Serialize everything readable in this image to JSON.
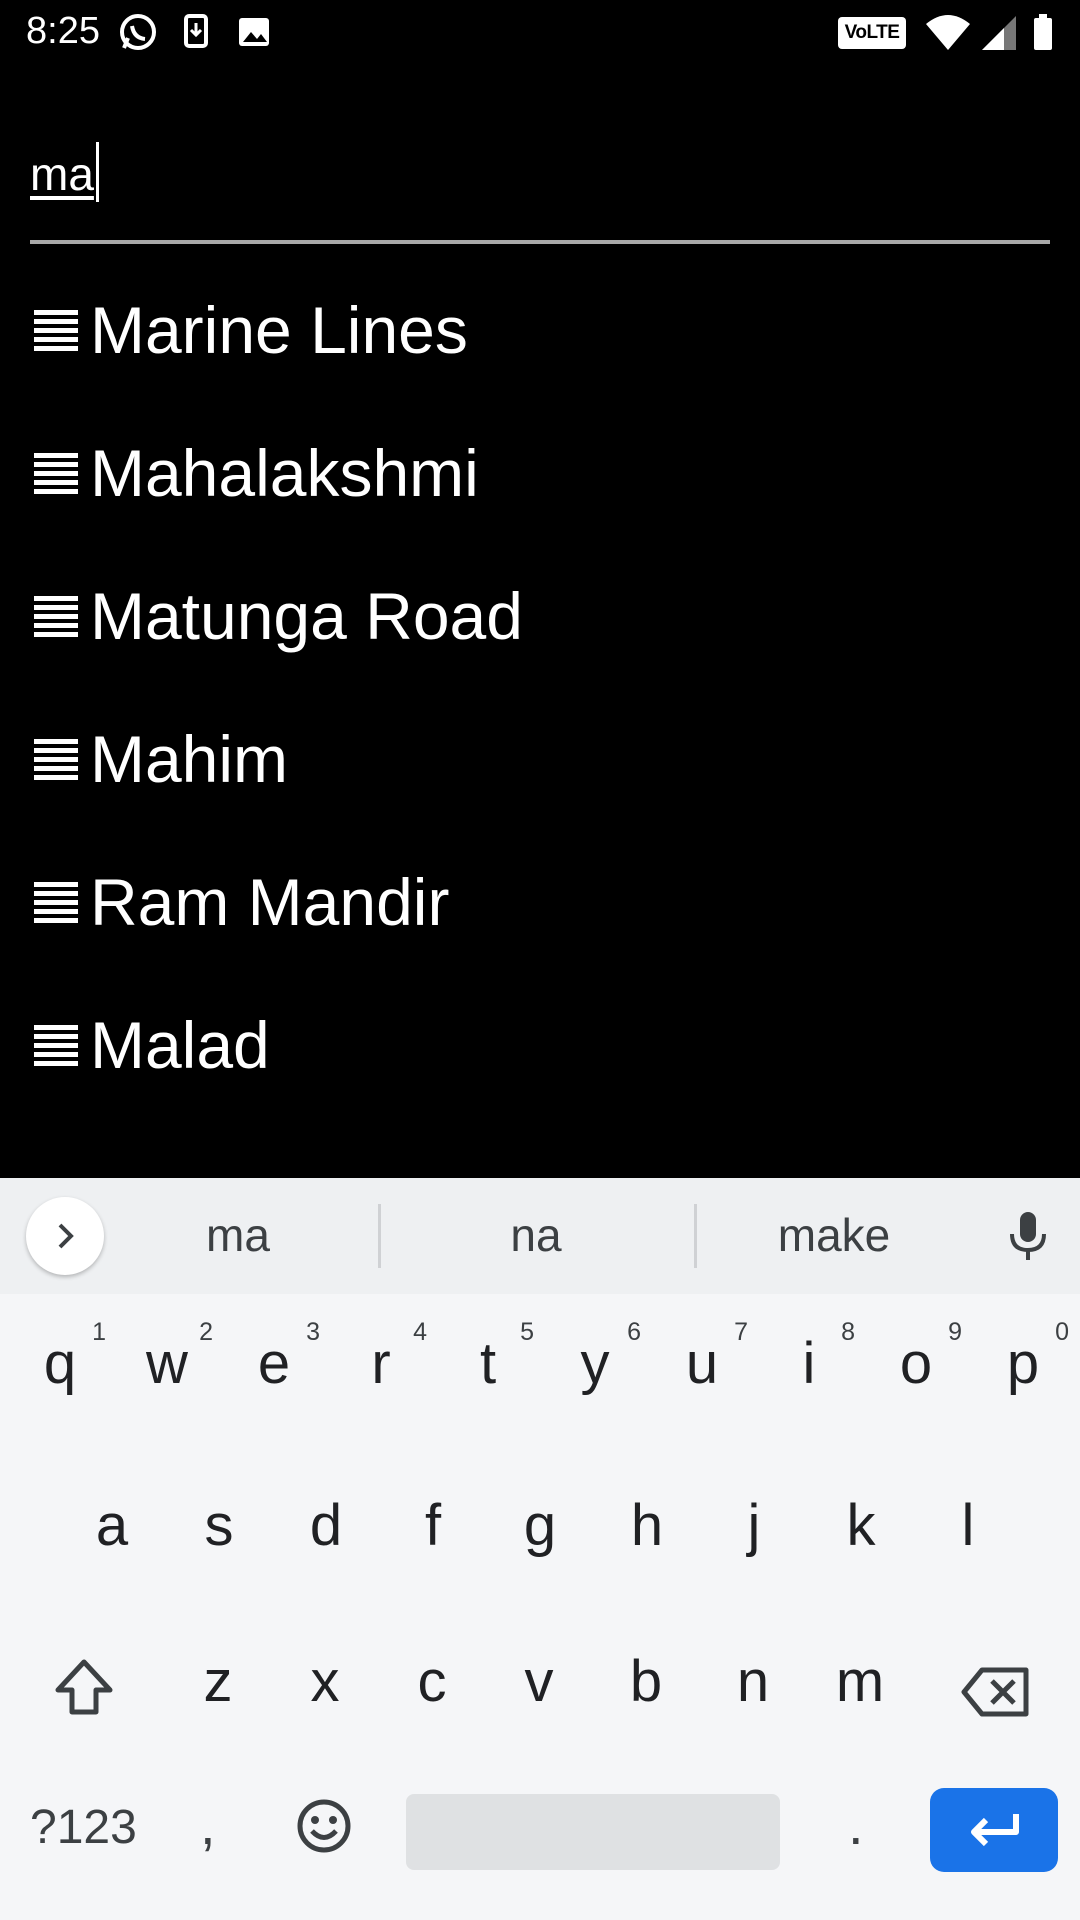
{
  "status_bar": {
    "time": "8:25",
    "volte": "VoLTE",
    "icons": [
      "whatsapp-icon",
      "download-icon",
      "image-icon",
      "wifi-icon",
      "signal-icon",
      "battery-icon"
    ]
  },
  "search": {
    "value": "ma"
  },
  "stations": [
    {
      "label": "Marine Lines",
      "icon": "list-icon"
    },
    {
      "label": "Mahalakshmi",
      "icon": "list-icon"
    },
    {
      "label": "Matunga Road",
      "icon": "list-icon"
    },
    {
      "label": "Mahim",
      "icon": "list-icon"
    },
    {
      "label": "Ram Mandir",
      "icon": "list-icon"
    },
    {
      "label": "Malad",
      "icon": "list-icon"
    }
  ],
  "keyboard": {
    "suggestions": [
      "ma",
      "na",
      "make"
    ],
    "row1": [
      {
        "key": "q",
        "hint": "1"
      },
      {
        "key": "w",
        "hint": "2"
      },
      {
        "key": "e",
        "hint": "3"
      },
      {
        "key": "r",
        "hint": "4"
      },
      {
        "key": "t",
        "hint": "5"
      },
      {
        "key": "y",
        "hint": "6"
      },
      {
        "key": "u",
        "hint": "7"
      },
      {
        "key": "i",
        "hint": "8"
      },
      {
        "key": "o",
        "hint": "9"
      },
      {
        "key": "p",
        "hint": "0"
      }
    ],
    "row2": [
      "a",
      "s",
      "d",
      "f",
      "g",
      "h",
      "j",
      "k",
      "l"
    ],
    "row3": [
      "z",
      "x",
      "c",
      "v",
      "b",
      "n",
      "m"
    ],
    "symbols_label": "?123",
    "comma": ",",
    "period": ".",
    "accent_color": "#1a73e8"
  }
}
